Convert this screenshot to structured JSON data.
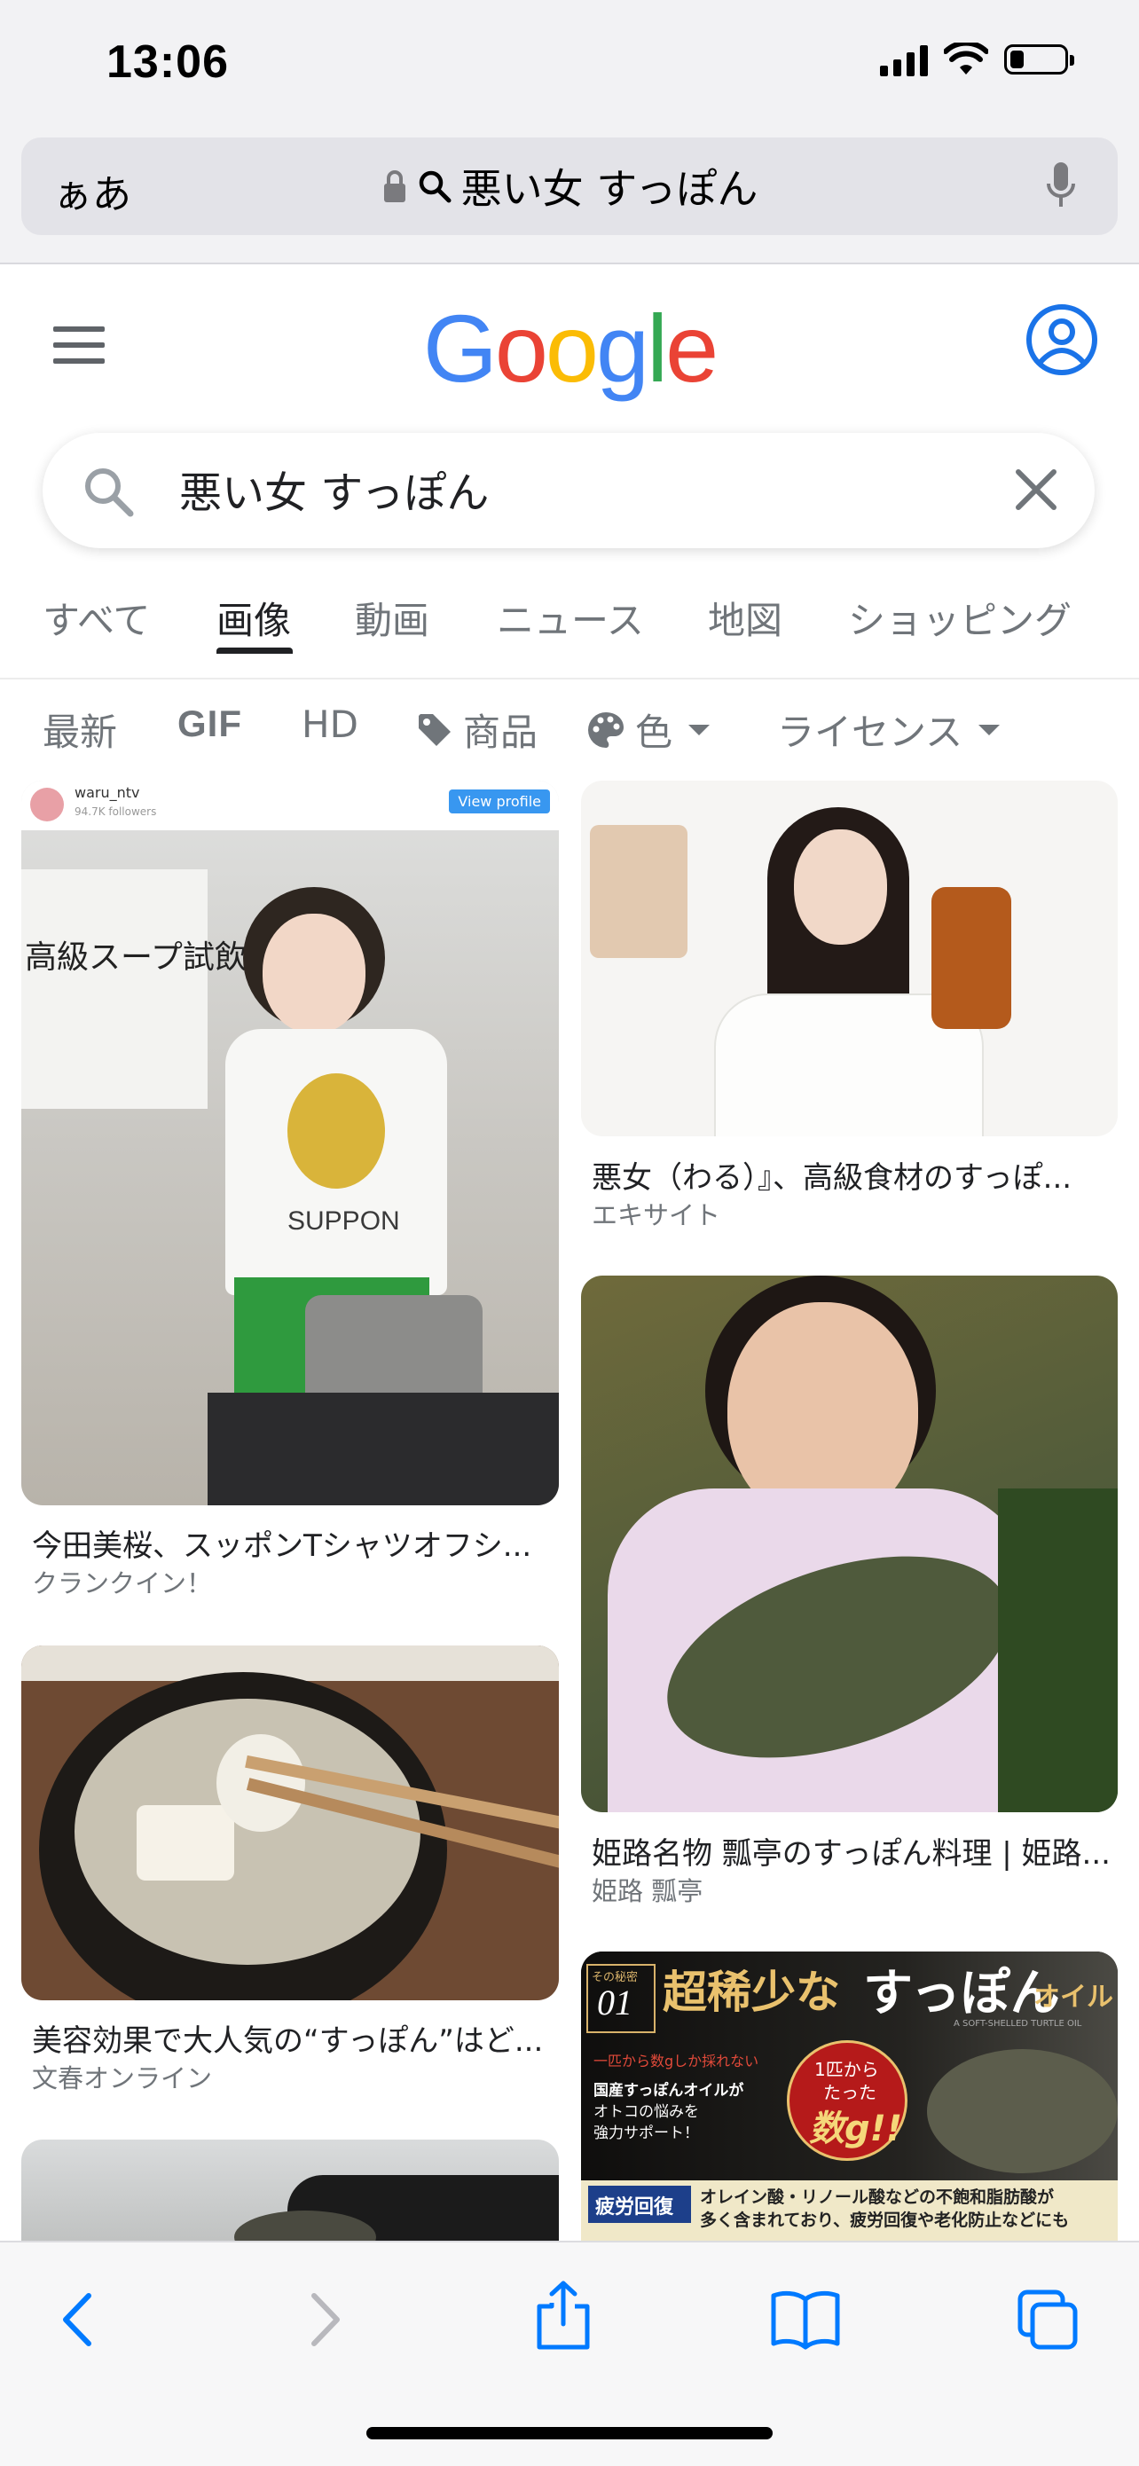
{
  "status_bar": {
    "time": "13:06",
    "battery_level": 0.25
  },
  "address_bar": {
    "aa_label": "ぁあ",
    "url_text": "悪い女 すっぽん"
  },
  "google": {
    "logo_letters": [
      "G",
      "o",
      "o",
      "g",
      "l",
      "e"
    ],
    "logo_colors": [
      "#4285F4",
      "#EA4335",
      "#FBBC05",
      "#4285F4",
      "#34A853",
      "#EA4335"
    ],
    "search_query": "悪い女 すっぽん"
  },
  "tabs": [
    "すべて",
    "画像",
    "動画",
    "ニュース",
    "地図",
    "ショッピング"
  ],
  "active_tab": "画像",
  "filters": {
    "latest": "最新",
    "gif": "GIF",
    "hd": "HD",
    "products": "商品",
    "color": "色",
    "license": "ライセンス"
  },
  "results": [
    {
      "title": "今田美桜、スッポンTシャツオフシ...",
      "source": "クランクイン！",
      "overlay": {
        "username": "waru_ntv",
        "followers": "94.7K followers",
        "button": "View profile",
        "board": "高級スープ試飲会",
        "shirt": "SUPPON"
      }
    },
    {
      "title": "悪女（わる）』、高級食材のすっぽ...",
      "source": "エキサイト"
    },
    {
      "title": "美容効果で大人気の“すっぽん”はど...",
      "source": "文春オンライン"
    },
    {
      "title": "姫路名物 瓢亭のすっぽん料理 | 姫路...",
      "source": "姫路 瓢亭"
    },
    {
      "title": "",
      "source": "",
      "overlay": {
        "badge_top": "その秘密",
        "badge_num": "01",
        "headline_a": "超稀少な",
        "headline_b": "すっぽん",
        "headline_c": "オイル",
        "sub": "A SOFT-SHELLED TURTLE OIL",
        "circle_a": "1匹から",
        "circle_b": "たった",
        "circle_c": "数g!!",
        "body1": "一匹から数gしか採れない",
        "body2": "国産すっぽんオイルが",
        "body3": "オトコの悩みを",
        "body4": "強力サポート！",
        "tag": "疲労回復",
        "band1": "オレイン酸・リノール酸などの不飽和脂肪酸が",
        "band2": "多く含まれており、疲労回復や老化防止などにも"
      }
    }
  ],
  "colors": {
    "accent_blue": "#1a73e8",
    "ios_blue": "#007aff"
  }
}
